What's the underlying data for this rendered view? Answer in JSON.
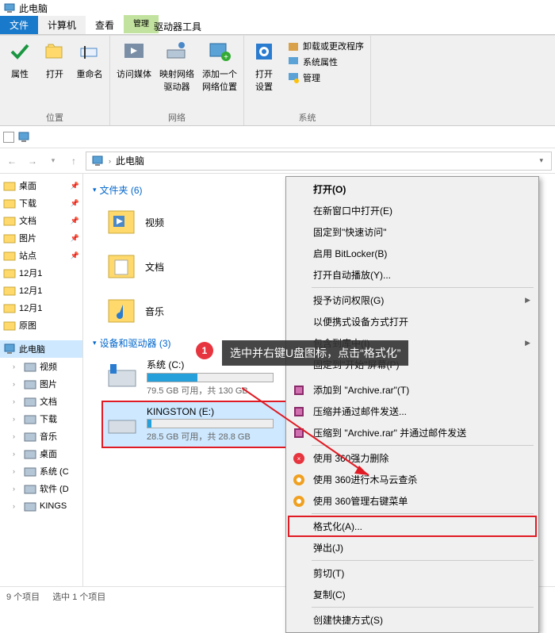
{
  "window": {
    "title": "此电脑"
  },
  "tabs": {
    "file": "文件",
    "computer": "计算机",
    "view": "查看",
    "manage": "管理",
    "drive_tools": "驱动器工具"
  },
  "ribbon": {
    "group_location": {
      "label": "位置",
      "properties": "属性",
      "open": "打开",
      "rename": "重命名"
    },
    "group_network": {
      "label": "网络",
      "access_media": "访问媒体",
      "map_drive": "映射网络\n驱动器",
      "add_location": "添加一个\n网络位置"
    },
    "group_system": {
      "label": "系统",
      "open_settings": "打开\n设置",
      "uninstall": "卸载或更改程序",
      "sys_props": "系统属性",
      "manage": "管理"
    }
  },
  "address": {
    "location": "此电脑"
  },
  "nav_pane": {
    "quick": [
      {
        "label": "桌面",
        "pin": true
      },
      {
        "label": "下载",
        "pin": true
      },
      {
        "label": "文档",
        "pin": true
      },
      {
        "label": "图片",
        "pin": true
      },
      {
        "label": "站点",
        "pin": true
      },
      {
        "label": "12月1"
      },
      {
        "label": "12月1"
      },
      {
        "label": "12月1"
      },
      {
        "label": "原图"
      }
    ],
    "this_pc": "此电脑",
    "tree": [
      {
        "label": "视频"
      },
      {
        "label": "图片"
      },
      {
        "label": "文档"
      },
      {
        "label": "下载"
      },
      {
        "label": "音乐"
      },
      {
        "label": "桌面"
      },
      {
        "label": "系统 (C"
      },
      {
        "label": "软件 (D"
      },
      {
        "label": "KINGS"
      }
    ]
  },
  "main": {
    "folders_header": "文件夹 (6)",
    "folders": [
      {
        "name": "视频"
      },
      {
        "name": "文档"
      },
      {
        "name": "音乐"
      }
    ],
    "drives_header": "设备和驱动器 (3)",
    "drives": [
      {
        "name": "系统 (C:)",
        "free": "79.5 GB 可用，共 130 GB",
        "fill_pct": 40
      },
      {
        "name": "KINGSTON (E:)",
        "free": "28.5 GB 可用，共 28.8 GB",
        "fill_pct": 3,
        "selected": true
      }
    ]
  },
  "callout": {
    "num": "1",
    "text": "选中并右键U盘图标，点击“格式化”"
  },
  "context_menu": {
    "items": [
      {
        "label": "打开(O)",
        "bold": true
      },
      {
        "label": "在新窗口中打开(E)"
      },
      {
        "label": "固定到\"快速访问\""
      },
      {
        "label": "启用 BitLocker(B)"
      },
      {
        "label": "打开自动播放(Y)..."
      },
      {
        "sep": true
      },
      {
        "label": "授予访问权限(G)",
        "sub": true
      },
      {
        "label": "以便携式设备方式打开"
      },
      {
        "label": "包含到库中(I)",
        "sub": true
      },
      {
        "label": "固定到\"开始\"屏幕(P)"
      },
      {
        "sep": true,
        "covered": true
      },
      {
        "label": "添加到 \"Archive.rar\"(T)",
        "icon": "rar"
      },
      {
        "label": "压缩并通过邮件发送...",
        "icon": "rar"
      },
      {
        "label": "压缩到 \"Archive.rar\" 并通过邮件发送",
        "icon": "rar"
      },
      {
        "sep": true
      },
      {
        "label": "使用 360强力删除",
        "icon": "360"
      },
      {
        "label": "使用 360进行木马云查杀",
        "icon": "360y"
      },
      {
        "label": "使用 360管理右键菜单",
        "icon": "360y"
      },
      {
        "sep": true
      },
      {
        "label": "格式化(A)...",
        "hl": true
      },
      {
        "label": "弹出(J)"
      },
      {
        "sep": true
      },
      {
        "label": "剪切(T)"
      },
      {
        "label": "复制(C)"
      },
      {
        "sep": true
      },
      {
        "label": "创建快捷方式(S)"
      }
    ]
  },
  "statusbar": {
    "count": "9 个项目",
    "selected": "选中 1 个项目"
  }
}
